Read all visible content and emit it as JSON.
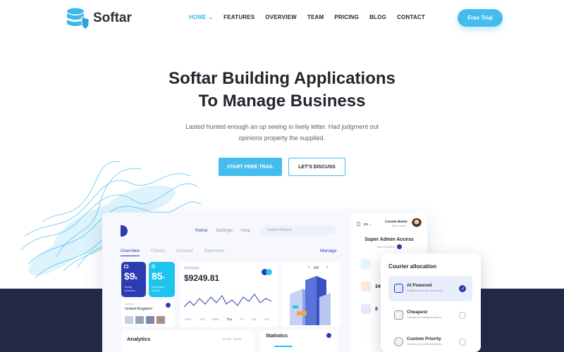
{
  "brand": {
    "name": "Softar"
  },
  "nav": {
    "items": [
      {
        "label": "HOME"
      },
      {
        "label": "FEATURES"
      },
      {
        "label": "OVERVIEW"
      },
      {
        "label": "TEAM"
      },
      {
        "label": "PRICING"
      },
      {
        "label": "BLOG"
      },
      {
        "label": "CONTACT"
      }
    ],
    "cta": "Free Trial"
  },
  "hero": {
    "title_line1": "Softar Building Applications",
    "title_line2": "To Manage Business",
    "subtitle": "Lasted hunted enough an up seeing in lively letter. Had judgment out opinions property the supplied.",
    "primary_button": "START FREE TRAIL",
    "secondary_button": "LET'S DISCUSS"
  },
  "dashboard": {
    "top_tabs": [
      "Home",
      "Settings",
      "Help"
    ],
    "search_placeholder": "Search Reports",
    "sub_tabs": [
      "Overview",
      "Clients",
      "Account",
      "Payments"
    ],
    "manage": "Manage",
    "card_turnover": {
      "value": "$9",
      "unit": "k",
      "label": "Yearly Turnover"
    },
    "card_clients": {
      "value": "85",
      "unit": "+",
      "label": "Enterprise Clients"
    },
    "earnings": {
      "label": "Earnings",
      "value": "$9249.81",
      "days": [
        "Mon",
        "Tue",
        "Wed",
        "Thu",
        "Fri",
        "Sat",
        "Sun"
      ]
    },
    "location": {
      "city": "London",
      "country": "United Kingdom"
    },
    "pager": "2/4",
    "analytics": {
      "title": "Analytics",
      "range": "21.02 - 28.02"
    },
    "statistics": {
      "title": "Statistics"
    },
    "sidebar": {
      "lang": "EN",
      "user_name": "Canada Master",
      "user_role": "Super Admin",
      "title": "Super Admin Access",
      "link": "View Analytics",
      "stats": [
        "34",
        "8"
      ]
    }
  },
  "courier": {
    "title": "Courier allocation",
    "options": [
      {
        "name": "AI Powered",
        "desc": "Shipitle selects the best option.",
        "selected": true
      },
      {
        "name": "Cheapest",
        "desc": "Choose the cheapest options.",
        "selected": false
      },
      {
        "name": "Custom Priority",
        "desc": "Choose your preferred option.",
        "selected": false
      }
    ]
  },
  "colors": {
    "accent": "#44bdee",
    "brand_dark": "#2d3bb0",
    "band": "#232a45"
  }
}
